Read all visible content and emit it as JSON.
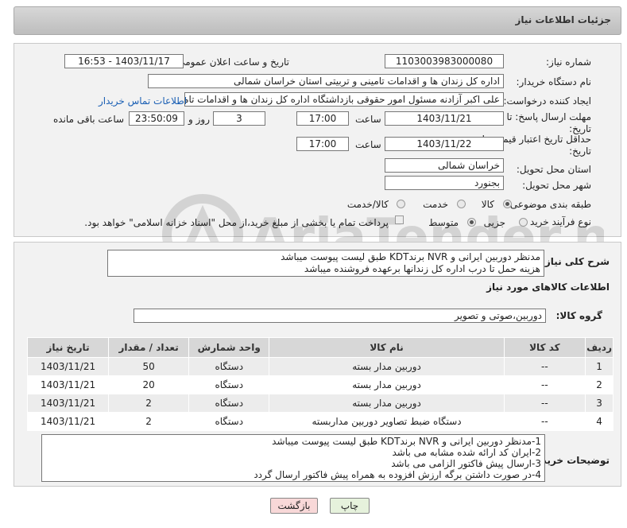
{
  "header": {
    "title": "جزئیات اطلاعات نیاز"
  },
  "need": {
    "number_label": "شماره نیاز:",
    "number_value": "1103003983000080",
    "announce_label": "تاریخ و ساعت اعلان عمومی:",
    "announce_value": "1403/11/17 - 16:53",
    "buyer_label": "نام دستگاه خریدار:",
    "buyer_value": "اداره کل زندان ها و اقدامات تامینی و تربیتی استان خراسان شمالی",
    "creator_label": "ایجاد کننده درخواست:",
    "creator_value": "علی اکبر  آزادنه مسئول امور حقوقی بازداشتگاه اداره کل زندان ها و اقدامات تامی",
    "contact_link": "اطلاعات تماس خریدار",
    "deadline_label_1": "مهلت ارسال پاسخ: تا",
    "deadline_label_2": "تاریخ:",
    "deadline_date": "1403/11/21",
    "time_label": "ساعت",
    "deadline_time": "17:00",
    "days_value": "3",
    "days_label": "روز و",
    "remaining_value": "23:50:09",
    "remaining_label": "ساعت باقی مانده",
    "validity_label_1": "حداقل تاریخ اعتبار قیمت: تا",
    "validity_label_2": "تاریخ:",
    "validity_date": "1403/11/22",
    "validity_time": "17:00",
    "province_label": "استان محل تحویل:",
    "province_value": "خراسان شمالی",
    "city_label": "شهر محل تحویل:",
    "city_value": "بجنورد",
    "category_label": "طبقه بندی موضوعی:",
    "category_options": [
      "کالا",
      "خدمت",
      "کالا/خدمت"
    ],
    "process_label": "نوع فرآیند خرید :",
    "process_options": [
      "جزیی",
      "متوسط"
    ],
    "payment_text": "پرداخت تمام یا بخشی از مبلغ خرید،از محل \"اسناد خزانه اسلامی\" خواهد بود."
  },
  "summary": {
    "label": "شرح کلی نیاز:",
    "line1": "مدنظر دوربین ایرانی و NVR برندKDT  طبق لیست پیوست میباشد",
    "line2": "هزینه حمل تا درب اداره کل زندانها برعهده فروشنده میباشد"
  },
  "goods": {
    "section_title": "اطلاعات کالاهای مورد نیاز",
    "group_label": "گروه کالا:",
    "group_value": "دوربین،صوتی و تصویر",
    "columns": [
      "ردیف",
      "کد کالا",
      "نام کالا",
      "واحد شمارش",
      "تعداد / مقدار",
      "تاریخ نیاز"
    ],
    "rows": [
      [
        "1",
        "--",
        "دوربین مدار بسته",
        "دستگاه",
        "50",
        "1403/11/21"
      ],
      [
        "2",
        "--",
        "دوربین مدار بسته",
        "دستگاه",
        "20",
        "1403/11/21"
      ],
      [
        "3",
        "--",
        "دوربین مدار بسته",
        "دستگاه",
        "2",
        "1403/11/21"
      ],
      [
        "4",
        "--",
        "دستگاه ضبط تصاویر دوربین مداربسته",
        "دستگاه",
        "2",
        "1403/11/21"
      ]
    ]
  },
  "buyer_notes": {
    "label": "توضیحات خریدار:",
    "lines": [
      "1-مدنظر دوربین ایرانی و NVR برندKDT  طبق لیست پیوست میباشد",
      "2-ایران کد ارائه شده مشابه می باشد",
      "3-ارسال پیش فاکتور الزامی می باشد",
      "4-در صورت داشتن برگه ارزش افزوده به همراه پیش فاکتور ارسال گردد"
    ]
  },
  "buttons": {
    "print": "چاپ",
    "back": "بازگشت"
  },
  "watermark": {
    "text": "AriaTender.neT"
  },
  "colors": {
    "link": "#1a5fb4",
    "back_button_bg": "#f8d8d8",
    "print_button_bg": "#e6f2dc"
  }
}
